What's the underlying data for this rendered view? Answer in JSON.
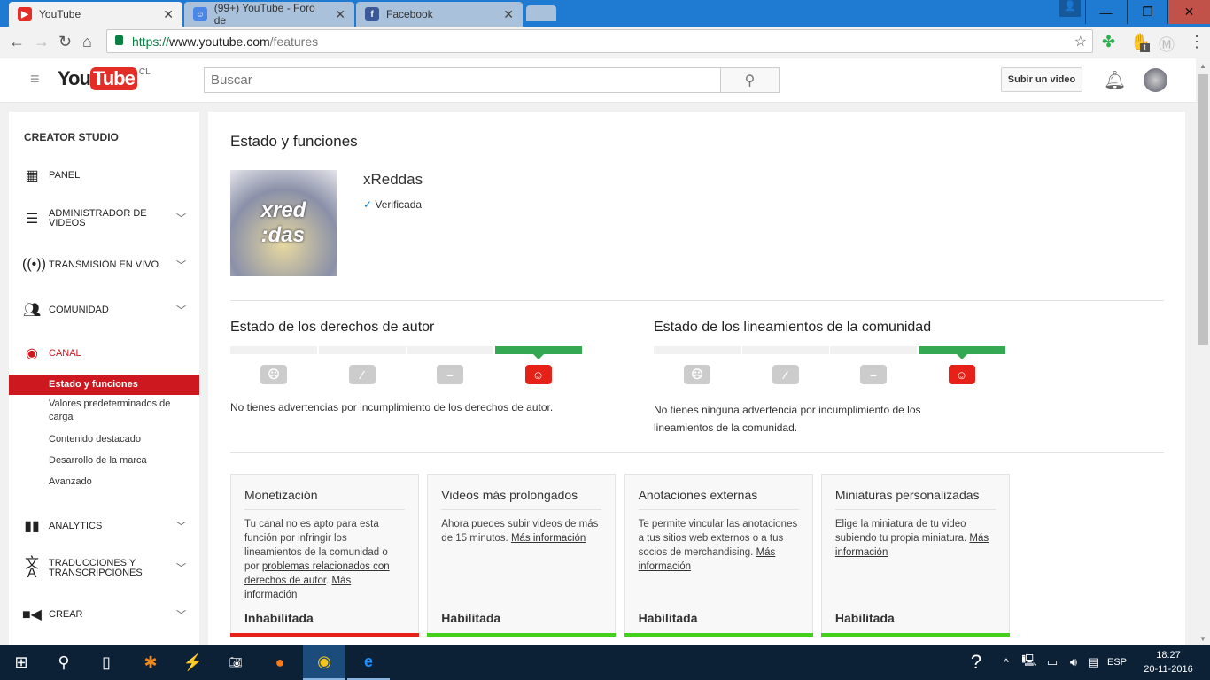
{
  "browser": {
    "tabs": [
      {
        "title": "YouTube",
        "icon": "youtube-icon",
        "active": true
      },
      {
        "title": "(99+) YouTube - Foro de",
        "icon": "google-groups-icon"
      },
      {
        "title": "Facebook",
        "icon": "facebook-icon"
      }
    ],
    "url_scheme": "https://",
    "url_host": "www.youtube.com",
    "url_path": "/features",
    "extension_badge": "1"
  },
  "header": {
    "logo_you": "You",
    "logo_tube": "Tube",
    "region": "CL",
    "search_placeholder": "Buscar",
    "upload_label": "Subir un video"
  },
  "sidebar": {
    "title": "CREATOR STUDIO",
    "items": [
      {
        "label": "PANEL",
        "icon": "dashboard-icon"
      },
      {
        "label": "ADMINISTRADOR DE VIDEOS",
        "icon": "video-manager-icon"
      },
      {
        "label": "TRANSMISIÓN EN VIVO",
        "icon": "live-icon"
      },
      {
        "label": "COMUNIDAD",
        "icon": "community-icon"
      },
      {
        "label": "CANAL",
        "icon": "channel-icon"
      },
      {
        "label": "ANALYTICS",
        "icon": "analytics-icon"
      },
      {
        "label": "TRADUCCIONES Y TRANSCRIPCIONES",
        "icon": "translate-icon"
      },
      {
        "label": "CREAR",
        "icon": "create-icon"
      }
    ],
    "canal_sub": [
      "Estado y funciones",
      "Valores predeterminados de carga",
      "Contenido destacado",
      "Desarrollo de la marca",
      "Avanzado"
    ]
  },
  "main": {
    "title": "Estado y funciones",
    "channel_name": "xReddas",
    "verified": "Verificada",
    "copyright": {
      "title": "Estado de los derechos de autor",
      "level": 4,
      "text": "No tienes advertencias por incumplimiento de los derechos de autor."
    },
    "community": {
      "title": "Estado de los lineamientos de la comunidad",
      "level": 4,
      "text": "No tienes ninguna advertencia por incumplimiento de los lineamientos de la comunidad."
    },
    "cards": [
      {
        "title": "Monetización",
        "text": "Tu canal no es apto para esta función por infringir los lineamientos de la comunidad o por ",
        "link1": "problemas relacionados con derechos de autor",
        "sep": ". ",
        "link2": "Más información",
        "status": "Inhabilitada",
        "color": "#e62117"
      },
      {
        "title": "Videos más prolongados",
        "text": "Ahora puedes subir videos de más de 15 minutos. ",
        "link1": "",
        "sep": "",
        "link2": "Más información",
        "status": "Habilitada",
        "color": "#43d01a"
      },
      {
        "title": "Anotaciones externas",
        "text": "Te permite vincular las anotaciones a tus sitios web externos o a tus socios de merchandising. ",
        "link1": "",
        "sep": "",
        "link2": "Más información",
        "status": "Habilitada",
        "color": "#43d01a"
      },
      {
        "title": "Miniaturas personalizadas",
        "text": "Elige la miniatura de tu video subiendo tu propia miniatura. ",
        "link1": "",
        "sep": "",
        "link2": "Más información",
        "status": "Habilitada",
        "color": "#43d01a"
      }
    ]
  },
  "taskbar": {
    "lang": "ESP",
    "time": "18:27",
    "date": "20-11-2016"
  },
  "colors": {
    "accent": "#cc181e",
    "good": "#34a853"
  }
}
